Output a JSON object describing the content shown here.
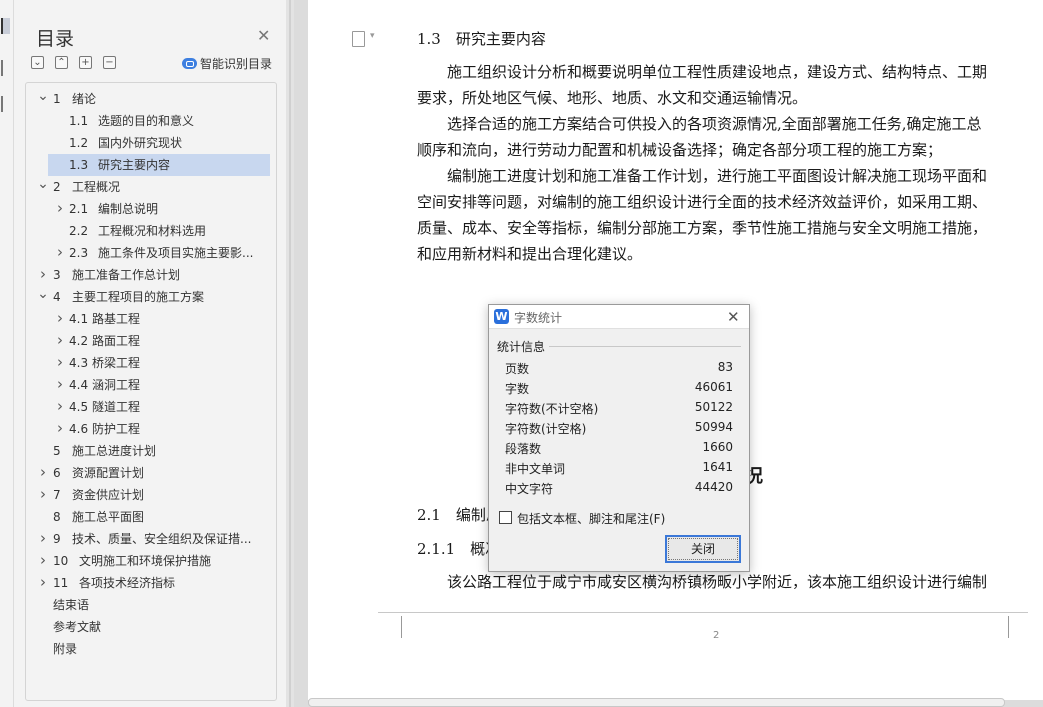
{
  "sidebar": {
    "title": "目录",
    "close_icon": "close-icon",
    "tools": [
      "collapse-all-icon",
      "expand-all-icon",
      "add-heading-icon",
      "remove-heading-icon"
    ],
    "smart_label": "智能识别目录",
    "items": [
      {
        "num": "1",
        "label": "绪论",
        "arrow": "expanded",
        "level": 1
      },
      {
        "num": "1.1",
        "label": "选题的目的和意义",
        "arrow": "none",
        "level": 2
      },
      {
        "num": "1.2",
        "label": "国内外研究现状",
        "arrow": "none",
        "level": 2
      },
      {
        "num": "1.3",
        "label": "研究主要内容",
        "arrow": "none",
        "level": 2,
        "active": true
      },
      {
        "num": "2",
        "label": "工程概况",
        "arrow": "expanded",
        "level": 1
      },
      {
        "num": "2.1",
        "label": "编制总说明",
        "arrow": "collapsed",
        "level": 2
      },
      {
        "num": "2.2",
        "label": "工程概况和材料选用",
        "arrow": "none",
        "level": 2
      },
      {
        "num": "2.3",
        "label": "施工条件及项目实施主要影...",
        "arrow": "collapsed",
        "level": 2
      },
      {
        "num": "3",
        "label": "施工准备工作总计划",
        "arrow": "collapsed",
        "level": 1
      },
      {
        "num": "4",
        "label": "主要工程项目的施工方案",
        "arrow": "expanded",
        "level": 1
      },
      {
        "num": "4.1",
        "label": "路基工程",
        "arrow": "collapsed",
        "level": 2
      },
      {
        "num": "4.2",
        "label": "路面工程",
        "arrow": "collapsed",
        "level": 2
      },
      {
        "num": "4.3",
        "label": "桥梁工程",
        "arrow": "collapsed",
        "level": 2
      },
      {
        "num": "4.4",
        "label": "涵洞工程",
        "arrow": "collapsed",
        "level": 2
      },
      {
        "num": "4.5",
        "label": "隧道工程",
        "arrow": "collapsed",
        "level": 2
      },
      {
        "num": "4.6",
        "label": "防护工程",
        "arrow": "collapsed",
        "level": 2
      },
      {
        "num": "5",
        "label": "施工总进度计划",
        "arrow": "none",
        "level": 1
      },
      {
        "num": "6",
        "label": "资源配置计划",
        "arrow": "collapsed",
        "level": 1
      },
      {
        "num": "7",
        "label": "资金供应计划",
        "arrow": "collapsed",
        "level": 1
      },
      {
        "num": "8",
        "label": "施工总平面图",
        "arrow": "none",
        "level": 1
      },
      {
        "num": "9",
        "label": "技术、质量、安全组织及保证措...",
        "arrow": "collapsed",
        "level": 1
      },
      {
        "num": "10",
        "label": "文明施工和环境保护措施",
        "arrow": "collapsed",
        "level": 1
      },
      {
        "num": "11",
        "label": "各项技术经济指标",
        "arrow": "collapsed",
        "level": 1
      },
      {
        "num": "",
        "label": "结束语",
        "arrow": "none",
        "level": 0
      },
      {
        "num": "",
        "label": "参考文献",
        "arrow": "none",
        "level": 0
      },
      {
        "num": "",
        "label": "附录",
        "arrow": "none",
        "level": 0
      }
    ]
  },
  "document": {
    "heading_13": "1.3　研究主要内容",
    "paragraphs": [
      "　　施工组织设计分析和概要说明单位工程性质建设地点，建设方式、结构特点、工期",
      "要求，所处地区气候、地形、地质、水文和交通运输情况。",
      "　　选择合适的施工方案结合可供投入的各项资源情况,全面部署施工任务,确定施工总",
      "顺序和流向，进行劳动力配置和机械设备选择；确定各部分项工程的施工方案；",
      "　　编制施工进度计划和施工准备工作计划，进行施工平面图设计解决施工现场平面和",
      "空间安排等问题，对编制的施工组织设计进行全面的技术经济效益评价，如采用工期、",
      "质量、成本、安全等指标，编制分部施工方案，季节性施工措施与安全文明施工措施，",
      "和应用新材料和提出合理化建议。"
    ],
    "chapter2_title_visible": "况",
    "heading_21": "2.1　编制总",
    "heading_211": "2.1.1　概况",
    "paragraph_last": "　　该公路工程位于咸宁市咸安区横沟桥镇杨畈小学附近，该本施工组织设计进行编制",
    "page_number": "2"
  },
  "dialog": {
    "title": "字数统计",
    "group_label": "统计信息",
    "stats": [
      {
        "label": "页数",
        "value": "83"
      },
      {
        "label": "字数",
        "value": "46061"
      },
      {
        "label": "字符数(不计空格)",
        "value": "50122"
      },
      {
        "label": "字符数(计空格)",
        "value": "50994"
      },
      {
        "label": "段落数",
        "value": "1660"
      },
      {
        "label": "非中文单词",
        "value": "1641"
      },
      {
        "label": "中文字符",
        "value": "44420"
      }
    ],
    "checkbox_label": "包括文本框、脚注和尾注(F)",
    "checkbox_checked": false,
    "close_label": "关闭"
  },
  "colors": {
    "accent": "#3b78d8",
    "selection": "#c8d7ef",
    "logo": "#2a6fdb"
  }
}
